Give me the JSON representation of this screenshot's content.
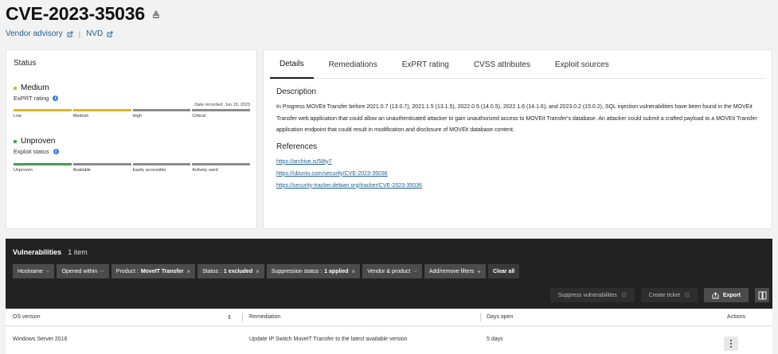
{
  "header": {
    "cve_id": "CVE-2023-35036",
    "links": [
      "Vendor advisory",
      "NVD"
    ]
  },
  "status": {
    "title": "Status",
    "exprt": {
      "level": "Medium",
      "label": "ExPRT rating",
      "recorded": "Date recorded: Jun 15, 2023",
      "scale": [
        "Low",
        "Medium",
        "High",
        "Critical"
      ],
      "active_segments": 2,
      "color": "#e0b42b"
    },
    "exploit": {
      "level": "Unproven",
      "label": "Exploit status",
      "scale": [
        "Unproven",
        "Available",
        "Easily accessible",
        "Actively used"
      ],
      "active_segments": 1,
      "color": "#4b9a55"
    }
  },
  "tabs": [
    "Details",
    "Remediations",
    "ExPRT rating",
    "CVSS attributes",
    "Exploit sources"
  ],
  "details": {
    "description_title": "Description",
    "description": "In Progress MOVEit Transfer before 2021.0.7 (13.0.7), 2021.1.5 (13.1.5), 2022.0.5 (14.0.5), 2022.1.6 (14.1.6), and 2023.0.2 (15.0.2), SQL injection vulnerabilities have been found in the MOVEit Transfer web application that could allow an unauthenticated attacker to gain unauthorized access to MOVEit Transfer's database. An attacker could submit a crafted payload to a MOVEit Transfer application endpoint that could result in modification and disclosure of MOVEit database content.",
    "references_title": "References",
    "references": [
      "https://archive.is/58ty7",
      "https://ubuntu.com/security/CVE-2023-35036",
      "https://security-tracker.debian.org/tracker/CVE-2023-35036"
    ]
  },
  "vulnerabilities": {
    "title": "Vulnerabilities",
    "count": "1 item",
    "filters": {
      "hostname": "Hostname",
      "opened_within": "Opened within",
      "product_label": "Product :",
      "product_value": "MoveIT Transfer",
      "status_label": "Status :",
      "status_value": "1 excluded",
      "suppression_label": "Suppression status :",
      "suppression_value": "1 applied",
      "vendor_product": "Vendor & product",
      "add_remove": "Add/remove filters",
      "clear_all": "Clear all"
    },
    "actions": {
      "suppress": "Suppress vulnerabilities",
      "ticket": "Create ticket",
      "export": "Export"
    },
    "columns": [
      "OS version",
      "Remediation",
      "Days open",
      "Actions"
    ],
    "rows": [
      {
        "os": "Windows Server 2016",
        "remediation": "Update IP Switch MoveIT Transfer to the latest available version",
        "days_open": "5 days"
      }
    ]
  }
}
